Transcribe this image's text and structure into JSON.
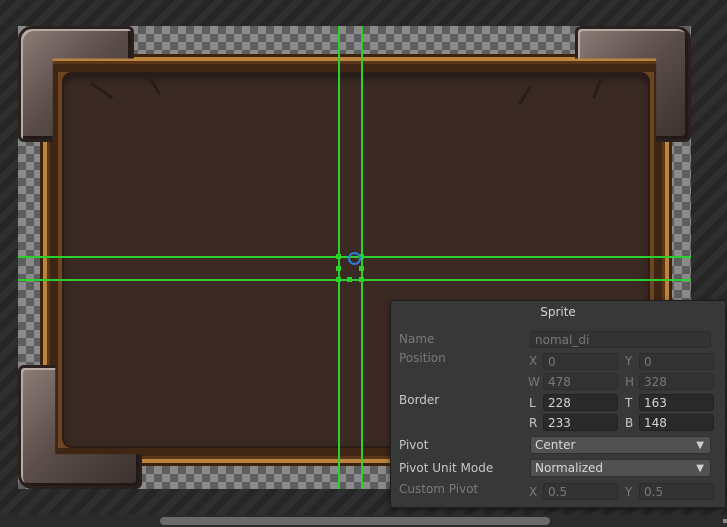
{
  "panel": {
    "title": "Sprite",
    "name": {
      "label": "Name",
      "value": "nomal_di"
    },
    "position": {
      "label": "Position",
      "x_label": "X",
      "x": "0",
      "y_label": "Y",
      "y": "0",
      "w_label": "W",
      "w": "478",
      "h_label": "H",
      "h": "328"
    },
    "border": {
      "label": "Border",
      "l_label": "L",
      "l": "228",
      "t_label": "T",
      "t": "163",
      "r_label": "R",
      "r": "233",
      "b_label": "B",
      "b": "148"
    },
    "pivot": {
      "label": "Pivot",
      "value": "Center"
    },
    "pivot_unit_mode": {
      "label": "Pivot Unit Mode",
      "value": "Normalized"
    },
    "custom_pivot": {
      "label": "Custom Pivot",
      "x_label": "X",
      "x": "0.5",
      "y_label": "Y",
      "y": "0.5"
    }
  },
  "icons": {
    "dropdown": "chevron-down-icon",
    "pivot": "pivot-handle-icon"
  },
  "colors": {
    "guide": "#2cd02c",
    "pivot": "#2a7bd8",
    "panel_bg": "#383838"
  }
}
